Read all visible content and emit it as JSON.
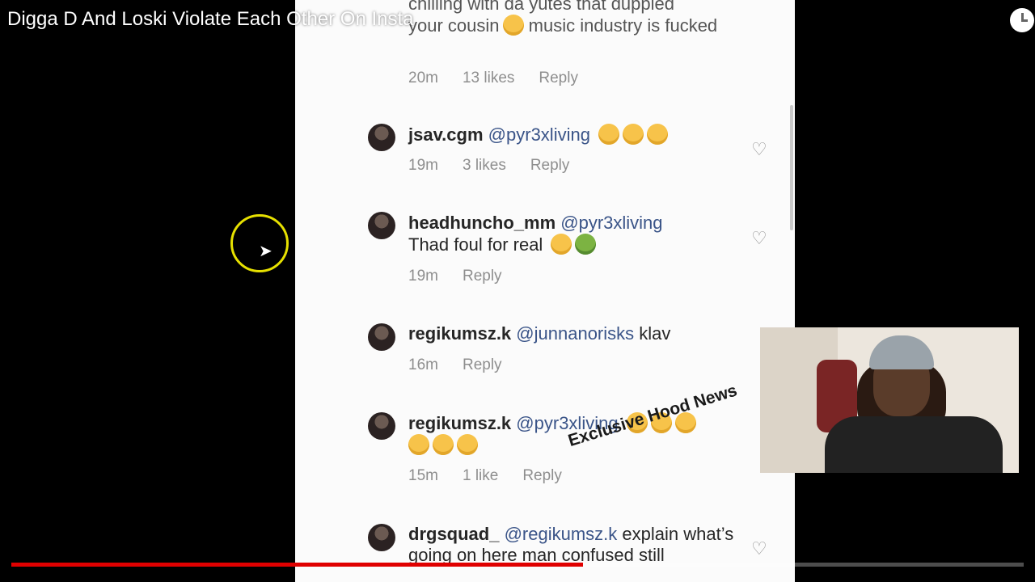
{
  "video": {
    "title": "Digga D And Loski Violate Each Other On Insta",
    "progress": 0.565,
    "accent_color": "#e00000"
  },
  "comments": [
    {
      "text_top": "chilling with da yutes that duppied",
      "text_mid": "your cousin",
      "text_end": "music industry is fucked",
      "time": "20m",
      "likes": "13 likes",
      "reply": "Reply"
    },
    {
      "user": "jsav.cgm",
      "mention": "@pyr3xliving",
      "time": "19m",
      "likes": "3 likes",
      "reply": "Reply"
    },
    {
      "user": "headhuncho_mm",
      "mention": "@pyr3xliving",
      "text": "Thad foul for real",
      "time": "19m",
      "reply": "Reply"
    },
    {
      "user": "regikumsz.k",
      "mention": "@junnanorisks",
      "text": "klav",
      "time": "16m",
      "reply": "Reply"
    },
    {
      "user": "regikumsz.k",
      "mention": "@pyr3xliving",
      "time": "15m",
      "likes": "1 like",
      "reply": "Reply"
    },
    {
      "user": "drgsquad_",
      "mention": "@regikumsz.k",
      "text": "explain what’s going on here man confused still",
      "time": "",
      "reply": ""
    }
  ],
  "watermark": "Exclusive Hood News",
  "icons": {
    "heart": "heart-icon",
    "clock": "watch-later-icon"
  }
}
